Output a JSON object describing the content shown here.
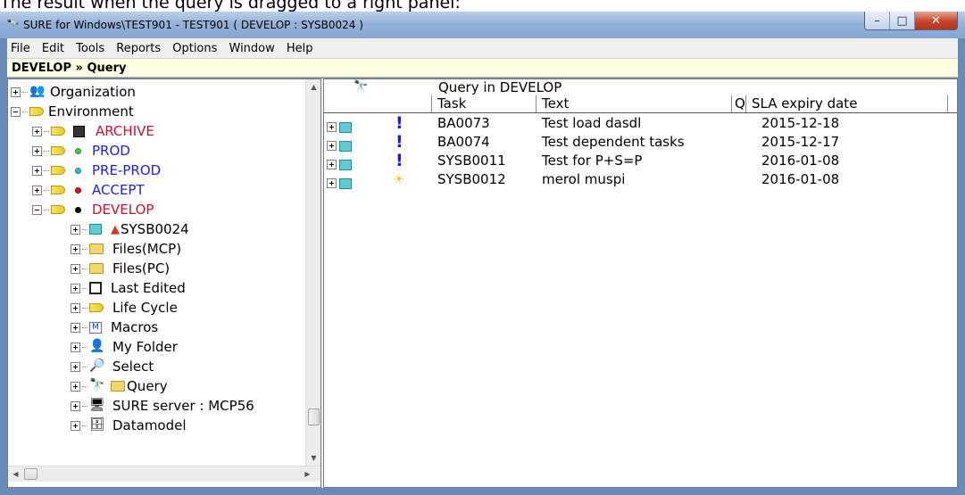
{
  "caption": "The result when the query is dragged to a right panel:",
  "window": {
    "title": "SURE for Windows\\TEST901 - TEST901 ( DEVELOP : SYSB0024 )",
    "buttons": {
      "minimize": "–",
      "maximize": "□",
      "close": "✕"
    }
  },
  "menu": [
    "File",
    "Edit",
    "Tools",
    "Reports",
    "Options",
    "Window",
    "Help"
  ],
  "breadcrumb": "DEVELOP » Query",
  "tree": {
    "nodes": [
      {
        "label": "Organization",
        "icon": "organization-icon"
      },
      {
        "label": "Environment",
        "icon": "environment-icon"
      },
      {
        "label": "ARCHIVE",
        "icon": "environment-icon",
        "color": "#c8102e"
      },
      {
        "label": "PROD",
        "icon": "environment-icon",
        "color": "#2124d4",
        "dot": "#56c15a"
      },
      {
        "label": "PRE-PROD",
        "icon": "environment-icon",
        "color": "#2124d4",
        "dot": "#35b6d6"
      },
      {
        "label": "ACCEPT",
        "icon": "environment-icon",
        "color": "#2124d4",
        "dot": "#d4141b"
      },
      {
        "label": "DEVELOP",
        "icon": "environment-icon",
        "color": "#c8102e",
        "dot": "#000000"
      },
      {
        "label": "SYSB0024",
        "icon": "task-icon"
      },
      {
        "label": "Files(MCP)",
        "icon": "folder-icon"
      },
      {
        "label": "Files(PC)",
        "icon": "folder-icon"
      },
      {
        "label": "Last Edited",
        "icon": "last-edited-icon"
      },
      {
        "label": "Life Cycle",
        "icon": "lifecycle-icon"
      },
      {
        "label": "Macros",
        "icon": "macros-icon"
      },
      {
        "label": "My Folder",
        "icon": "my-folder-icon"
      },
      {
        "label": "Select",
        "icon": "select-icon"
      },
      {
        "label": "Query",
        "icon": "binoculars-icon"
      },
      {
        "label": "SURE server : MCP56",
        "icon": "server-icon"
      },
      {
        "label": "Datamodel",
        "icon": "datamodel-icon"
      }
    ]
  },
  "query_grid": {
    "title": "Query  in DEVELOP",
    "columns": {
      "task": "Task",
      "text": "Text",
      "q": "Q",
      "sla": "SLA expiry date"
    },
    "rows": [
      {
        "mark": "!",
        "task": "BA0073",
        "text": "Test load dasdl",
        "sla": "2015-12-18"
      },
      {
        "mark": "!",
        "task": "BA0074",
        "text": "Test dependent tasks",
        "sla": "2015-12-17"
      },
      {
        "mark": "!",
        "task": "SYSB0011",
        "text": "Test for P+S=P",
        "sla": "2016-01-08"
      },
      {
        "mark": "☀",
        "task": "SYSB0012",
        "text": "merol muspi",
        "sla": "2016-01-08"
      }
    ]
  }
}
